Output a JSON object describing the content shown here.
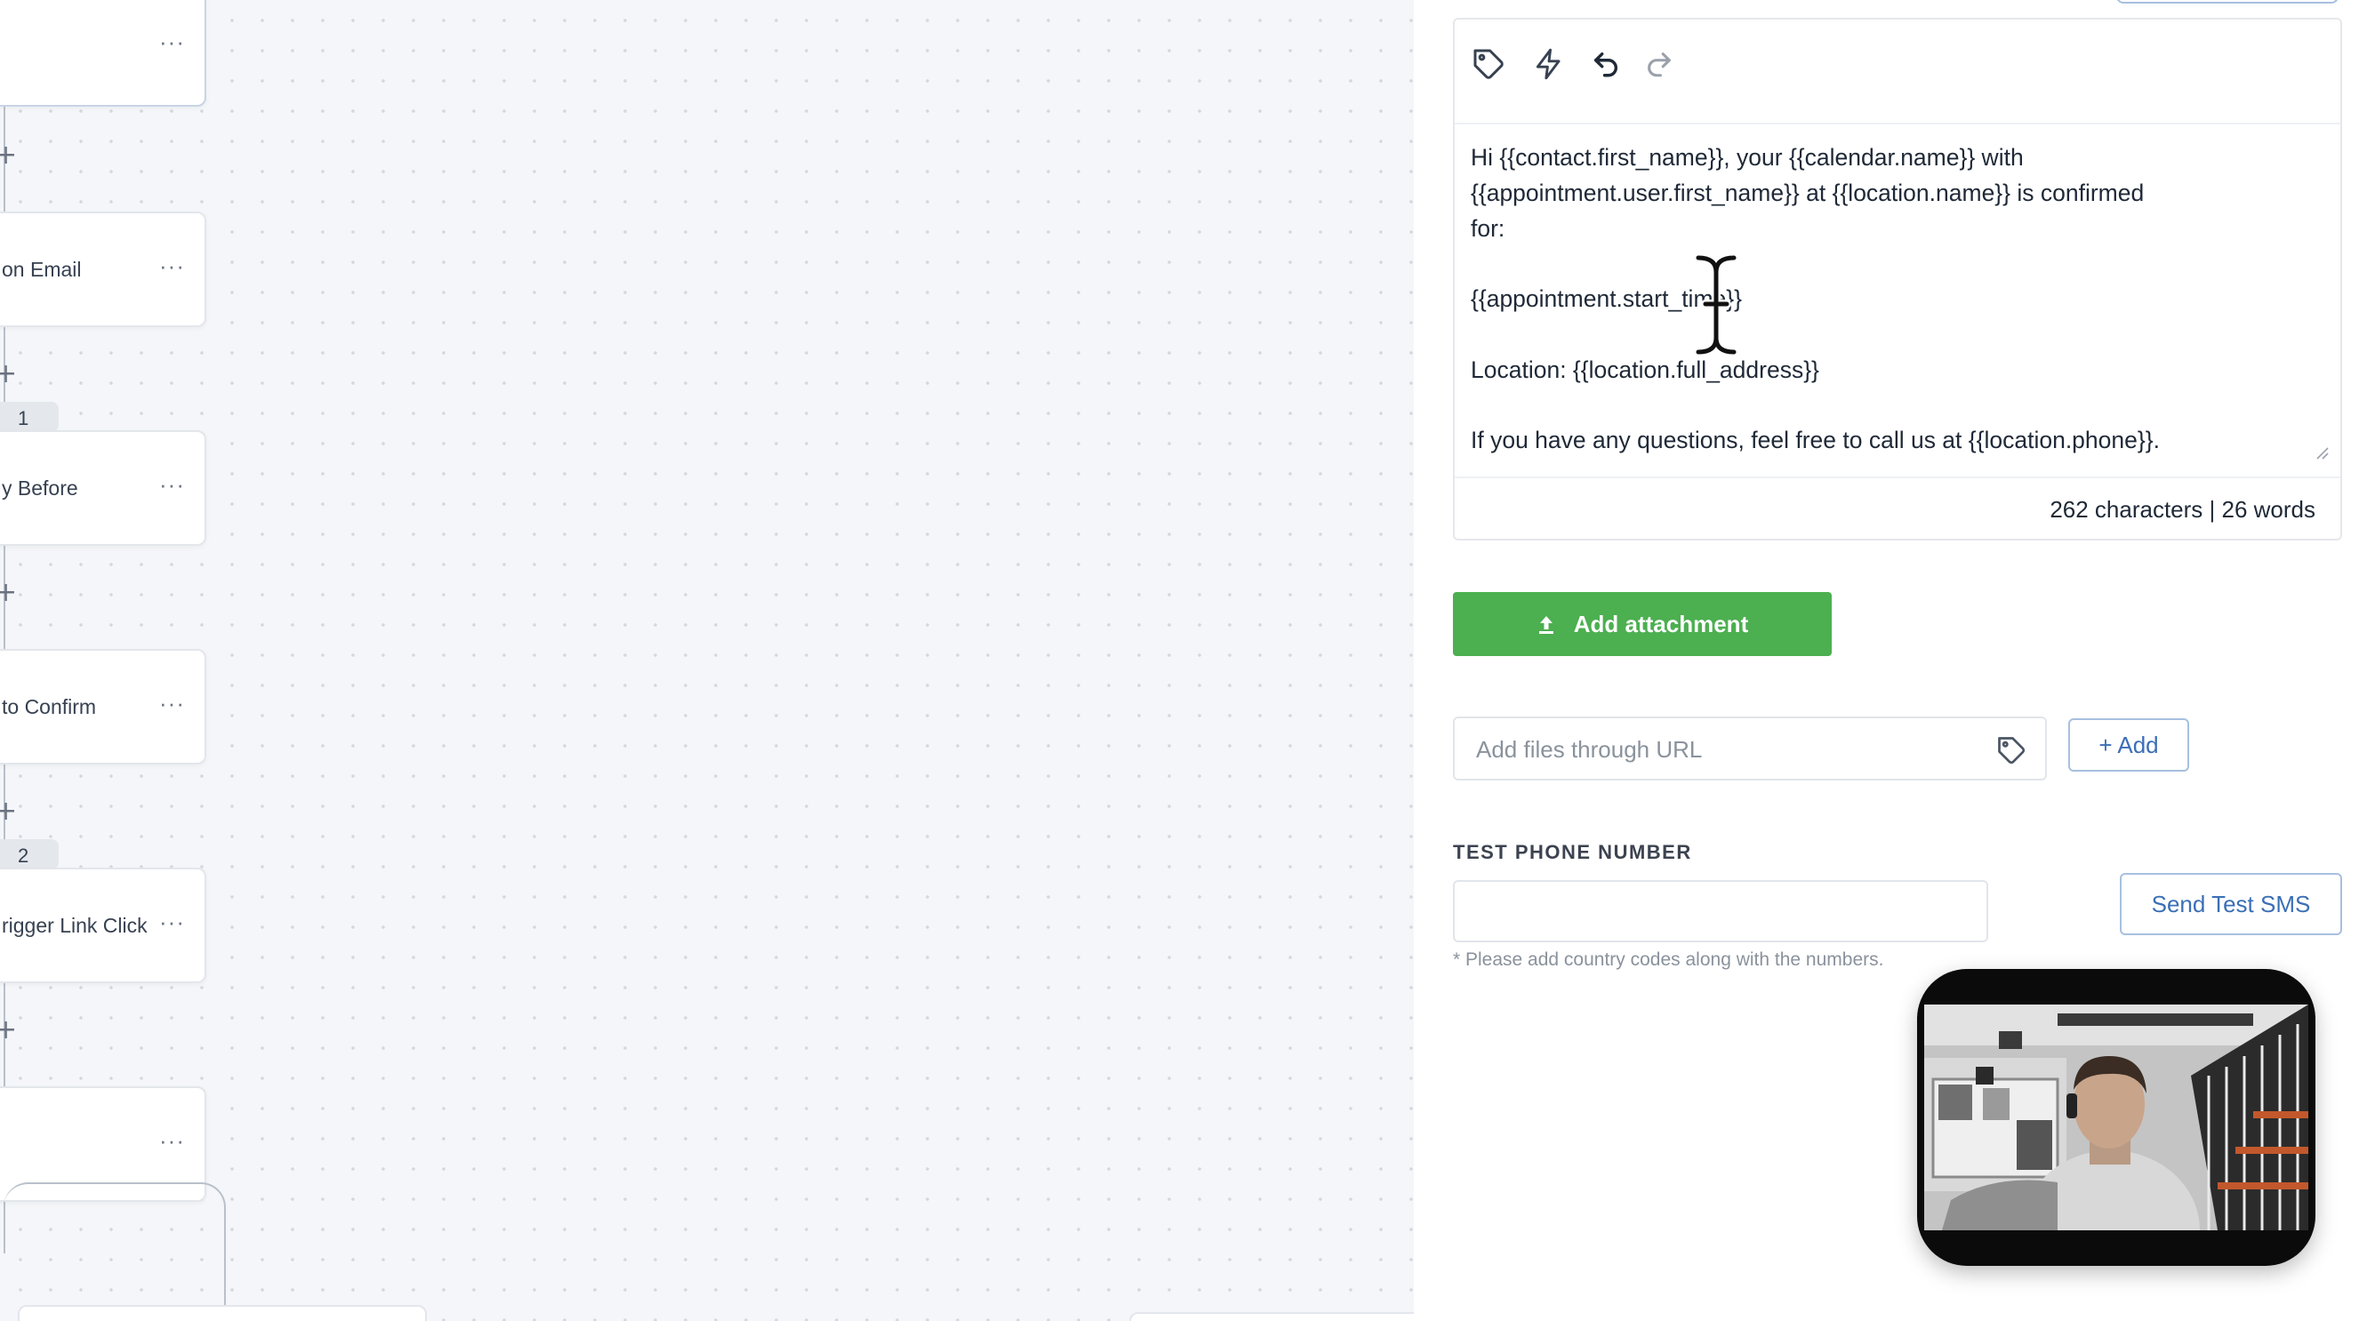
{
  "canvas": {
    "nodes": [
      {
        "label": ""
      },
      {
        "label": "on Email"
      },
      {
        "label": "y Before"
      },
      {
        "label": " to Confirm"
      },
      {
        "label": "rigger Link Click"
      },
      {
        "label": ""
      }
    ],
    "node_menu": "···",
    "branch_badges": [
      "1",
      "2"
    ],
    "plus": "+"
  },
  "editor": {
    "toolbar_icons": [
      "tag-icon",
      "lightning-icon",
      "undo-icon",
      "redo-icon"
    ],
    "message": "Hi {{contact.first_name}}, your {{calendar.name}} with\n{{appointment.user.first_name}} at {{location.name}} is confirmed\nfor:\n\n{{appointment.start_time}}\n\nLocation: {{location.full_address}}\n\nIf you have any questions, feel free to call us at {{location.phone}}.",
    "counter": "262 characters | 26 words"
  },
  "attachment": {
    "button_label": "Add attachment",
    "url_placeholder": "Add files through URL",
    "add_label": "+ Add"
  },
  "test_sms": {
    "section_label": "TEST PHONE NUMBER",
    "phone_value": "",
    "send_label": "Send Test SMS",
    "hint": "* Please add country codes along with the numbers."
  },
  "colors": {
    "accent_green": "#4caf50",
    "link_blue": "#3b6fb6"
  }
}
